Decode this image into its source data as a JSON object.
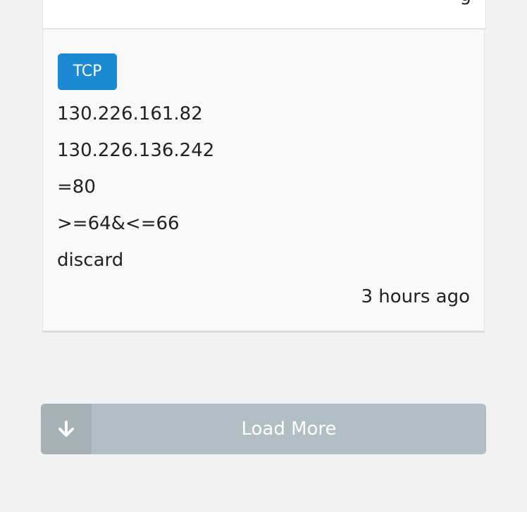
{
  "previous_card": {
    "cut_text": "g"
  },
  "card": {
    "protocol_badge": "TCP",
    "source_ip": "130.226.161.82",
    "destination_ip": "130.226.136.242",
    "port": "=80",
    "ttl": ">=64&<=66",
    "action": "discard",
    "timestamp": "3 hours ago",
    "badge_color": "#1b8ad3"
  },
  "load_more": {
    "label": "Load More",
    "icon": "arrow-down-icon",
    "color": "#b1bec3"
  }
}
